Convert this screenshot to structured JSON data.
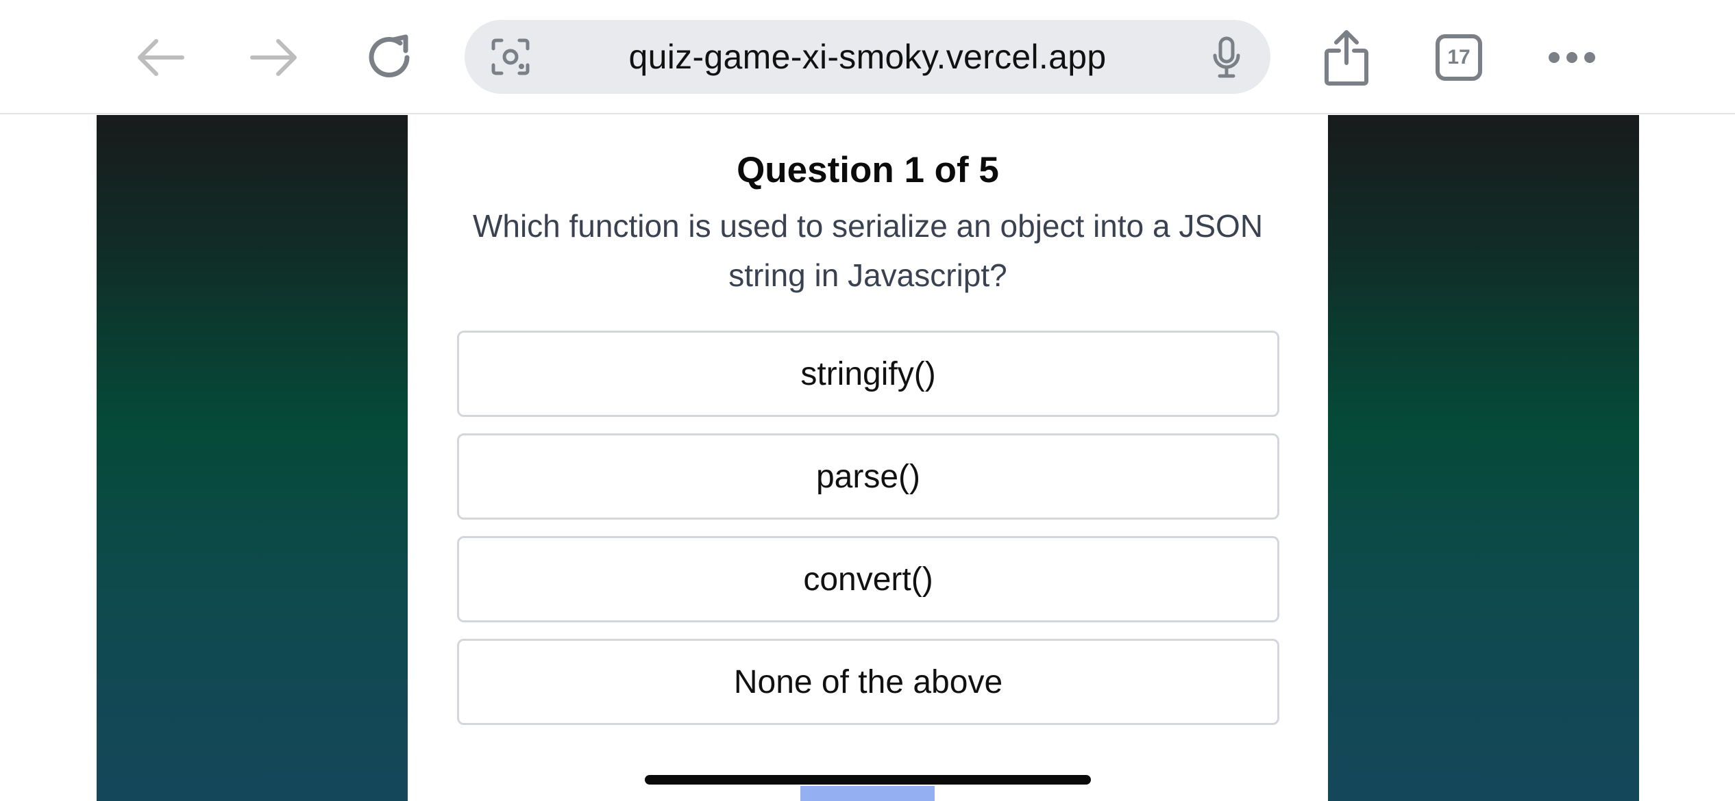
{
  "browser": {
    "url": "quiz-game-xi-smoky.vercel.app",
    "tabs_count": "17",
    "icons": {
      "back": "arrow-left-icon",
      "forward": "arrow-right-icon",
      "reload": "reload-icon",
      "lens": "camera-search-icon",
      "mic": "microphone-icon",
      "share": "share-icon",
      "more": "more-dots-icon"
    }
  },
  "quiz": {
    "heading": "Question 1 of 5",
    "question": "Which function is used to serialize an object into a JSON string in Javascript?",
    "options": [
      "stringify()",
      "parse()",
      "convert()",
      "None of the above"
    ]
  },
  "colors": {
    "gradient_top": "#181b1b",
    "gradient_mid": "#054a38",
    "gradient_bottom": "#15475a",
    "option_border": "#d3d6db",
    "question_text": "#3a4252"
  }
}
